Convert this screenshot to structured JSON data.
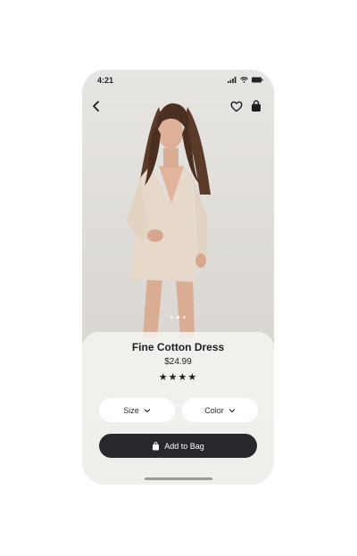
{
  "status_bar": {
    "time": "4:21"
  },
  "product": {
    "name": "Fine Cotton Dress",
    "price": "$24.99",
    "rating_stars": "★★★★",
    "rating": 4
  },
  "options": {
    "size_label": "Size",
    "color_label": "Color"
  },
  "actions": {
    "add_to_bag_label": "Add to Bag"
  },
  "carousel": {
    "count": 3,
    "active_index": 1
  },
  "colors": {
    "button_dark": "#26282b",
    "sheet_bg": "#f6f5f3",
    "background": "#e2dfdb"
  },
  "icons": [
    "back-arrow-icon",
    "heart-icon",
    "bag-icon",
    "signal-icon",
    "wifi-icon",
    "battery-icon",
    "chevron-down-icon"
  ]
}
